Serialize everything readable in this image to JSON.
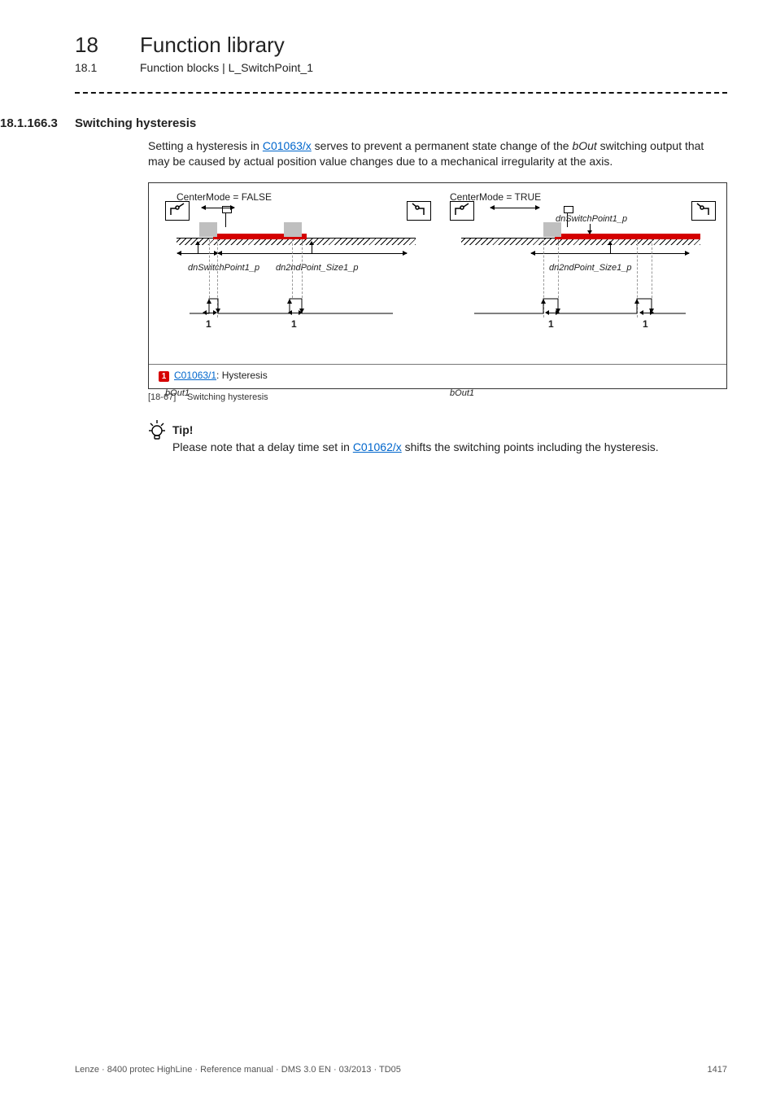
{
  "chapter": {
    "num": "18",
    "title": "Function library"
  },
  "sub": {
    "num": "18.1",
    "title": "Function blocks | L_SwitchPoint_1"
  },
  "section": {
    "num": "18.1.166.3",
    "title": "Switching hysteresis"
  },
  "para1_a": "Setting a hysteresis in ",
  "link1": "C01063/x",
  "para1_b": " serves to prevent a permanent state change of the ",
  "ital1": "bOut",
  "para1_c": " switching output that may be caused by actual position value changes due to a mechanical irregularity at the axis.",
  "diagram": {
    "mode_left": "CenterMode = FALSE",
    "mode_right": "CenterMode = TRUE",
    "sw1": "dnSwitchPoint1_p",
    "second": "dn2ndPoint_Size1_p",
    "bout": "bOut1",
    "marker": "1",
    "caption_num": "1",
    "caption_link": "C01063/1",
    "caption_text": ": Hysteresis"
  },
  "figcap": {
    "num": "[18-67]",
    "text": "Switching hysteresis"
  },
  "tip": {
    "title": "Tip!",
    "a": "Please note that a delay time set in ",
    "link": "C01062/x",
    "b": " shifts the switching points including the hysteresis."
  },
  "footer": {
    "left": "Lenze · 8400 protec HighLine · Reference manual · DMS 3.0 EN · 03/2013 · TD05",
    "right": "1417"
  }
}
